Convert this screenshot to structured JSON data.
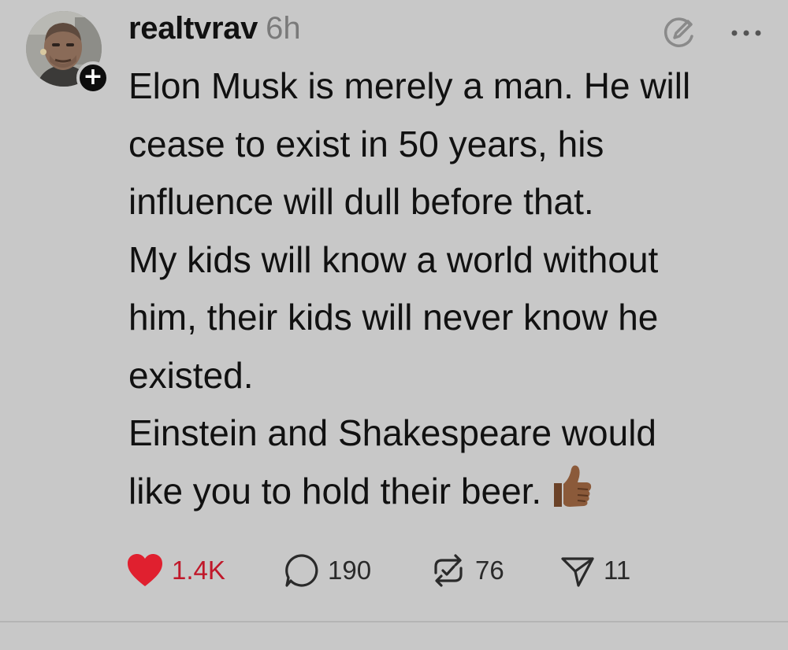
{
  "post": {
    "username": "realtvrav",
    "time": "6h",
    "text_lines": [
      "Elon Musk is merely a man. He will",
      "cease to exist in 50 years, his",
      "influence will dull before that.",
      "My kids will know a world without",
      "him, their kids will never know he",
      "existed.",
      "Einstein and Shakespeare would",
      "like you to hold their beer."
    ],
    "emoji": "thumbs-up-medium-dark-skin",
    "follow_badge": "+",
    "actions": {
      "likes": "1.4K",
      "replies": "190",
      "reposts": "76",
      "shares": "11"
    }
  },
  "colors": {
    "background": "#c8c8c8",
    "like_red": "#c0182a",
    "text": "#111111",
    "muted": "#7a7a7a"
  },
  "icons": {
    "header": [
      "edit-icon",
      "more-icon"
    ],
    "actions": [
      "heart-icon",
      "comment-icon",
      "repost-icon",
      "share-icon"
    ]
  }
}
